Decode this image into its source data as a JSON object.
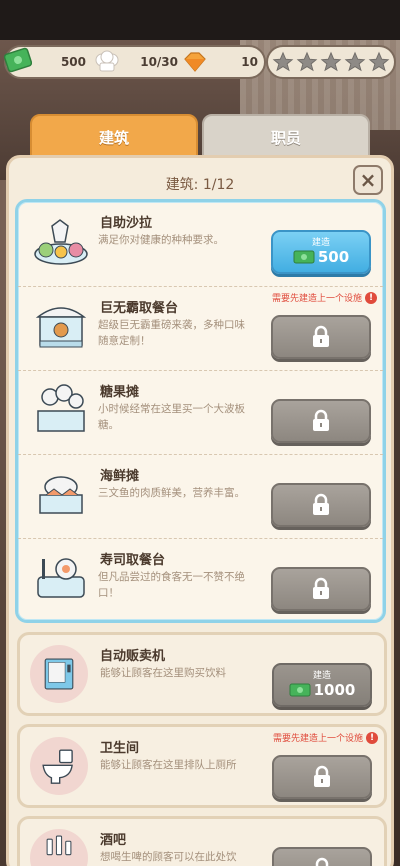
{
  "hud": {
    "money": "500",
    "chef": "10/30",
    "gems": "10",
    "stars_filled": 0,
    "stars_total": 5
  },
  "tabs": [
    {
      "label": "建筑",
      "active": true
    },
    {
      "label": "职员",
      "active": false
    }
  ],
  "panel": {
    "title": "建筑: 1/12",
    "close_label": "×"
  },
  "items": [
    {
      "name": "自助沙拉",
      "desc": "满足你对健康的种种要求。",
      "state": "buildable",
      "btn_label": "建造",
      "price": "500"
    },
    {
      "name": "巨无霸取餐台",
      "desc": "超级巨无霸重磅来袭，多种口味随意定制！",
      "state": "locked",
      "warning": "需要先建造上一个设施"
    },
    {
      "name": "糖果摊",
      "desc": "小时候经常在这里买一个大波板糖。",
      "state": "locked"
    },
    {
      "name": "海鲜摊",
      "desc": "三文鱼的肉质鲜美，营养丰富。",
      "state": "locked"
    },
    {
      "name": "寿司取餐台",
      "desc": "但凡品尝过的食客无一不赞不绝口！",
      "state": "locked"
    }
  ],
  "cards": [
    {
      "name": "自动贩卖机",
      "desc": "能够让顾客在这里购买饮料",
      "state": "buildable",
      "btn_label": "建造",
      "price": "1000"
    },
    {
      "name": "卫生间",
      "desc": "能够让顾客在这里排队上厕所",
      "state": "locked",
      "warning": "需要先建造上一个设施"
    },
    {
      "name": "酒吧",
      "desc": "想喝生啤的顾客可以在此处饮",
      "state": "locked"
    }
  ],
  "colors": {
    "accent_orange": "#f2a84a",
    "highlight_blue": "#8fd2e8",
    "build_blue": "#42aee2",
    "warning_red": "#e04b3c"
  }
}
